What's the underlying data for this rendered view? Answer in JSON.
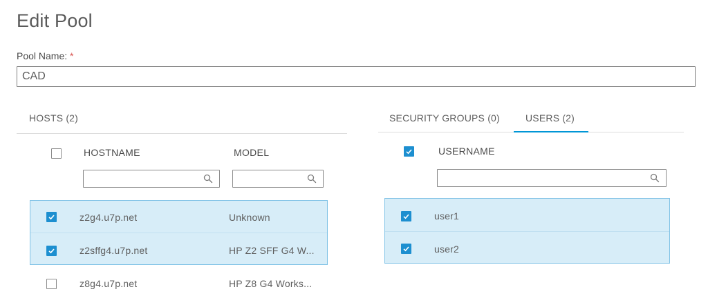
{
  "page": {
    "title": "Edit Pool"
  },
  "pool_name": {
    "label": "Pool Name:",
    "required_mark": "*",
    "value": "CAD"
  },
  "hosts": {
    "tab_label": "HOSTS (2)",
    "header_checked": false,
    "columns": {
      "hostname": "HOSTNAME",
      "model": "MODEL"
    },
    "rows": [
      {
        "hostname": "z2g4.u7p.net",
        "model": "Unknown",
        "checked": true
      },
      {
        "hostname": "z2sffg4.u7p.net",
        "model": "HP Z2 SFF G4 W...",
        "checked": true
      },
      {
        "hostname": "z8g4.u7p.net",
        "model": "HP Z8 G4 Works...",
        "checked": false
      }
    ]
  },
  "tabs": {
    "security_groups": "SECURITY GROUPS (0)",
    "users": "USERS (2)",
    "active": "users"
  },
  "users": {
    "header_checked": true,
    "columns": {
      "username": "USERNAME"
    },
    "rows": [
      {
        "username": "user1",
        "checked": true
      },
      {
        "username": "user2",
        "checked": true
      }
    ]
  },
  "colors": {
    "accent": "#0096d6",
    "checkbox_fill": "#1d8fd0",
    "selection_bg": "#d7edf8",
    "selection_border": "#80c2e6",
    "required": "#d9534f"
  }
}
